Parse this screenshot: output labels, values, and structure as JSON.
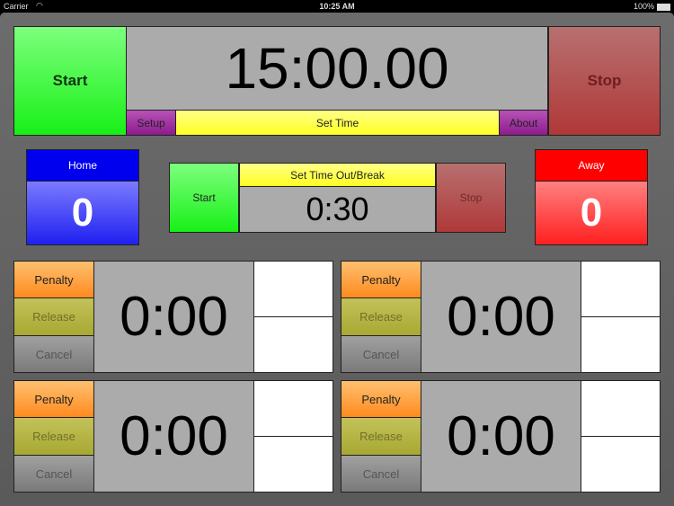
{
  "status_bar": {
    "carrier": "Carrier",
    "wifi_icon": "wifi-icon",
    "time": "10:25 AM",
    "battery": "100%",
    "battery_icon": "battery-icon"
  },
  "main_clock": {
    "start_label": "Start",
    "time": "15:00.00",
    "stop_label": "Stop",
    "setup_label": "Setup",
    "set_time_label": "Set Time",
    "about_label": "About"
  },
  "home": {
    "label": "Home",
    "score": "0"
  },
  "away": {
    "label": "Away",
    "score": "0"
  },
  "timeout": {
    "start_label": "Start",
    "title": "Set Time Out/Break",
    "time": "0:30",
    "stop_label": "Stop"
  },
  "penalties": [
    {
      "penalty_label": "Penalty",
      "release_label": "Release",
      "cancel_label": "Cancel",
      "time": "0:00",
      "slot1": "",
      "slot2": ""
    },
    {
      "penalty_label": "Penalty",
      "release_label": "Release",
      "cancel_label": "Cancel",
      "time": "0:00",
      "slot1": "",
      "slot2": ""
    },
    {
      "penalty_label": "Penalty",
      "release_label": "Release",
      "cancel_label": "Cancel",
      "time": "0:00",
      "slot1": "",
      "slot2": ""
    },
    {
      "penalty_label": "Penalty",
      "release_label": "Release",
      "cancel_label": "Cancel",
      "time": "0:00",
      "slot1": "",
      "slot2": ""
    }
  ]
}
